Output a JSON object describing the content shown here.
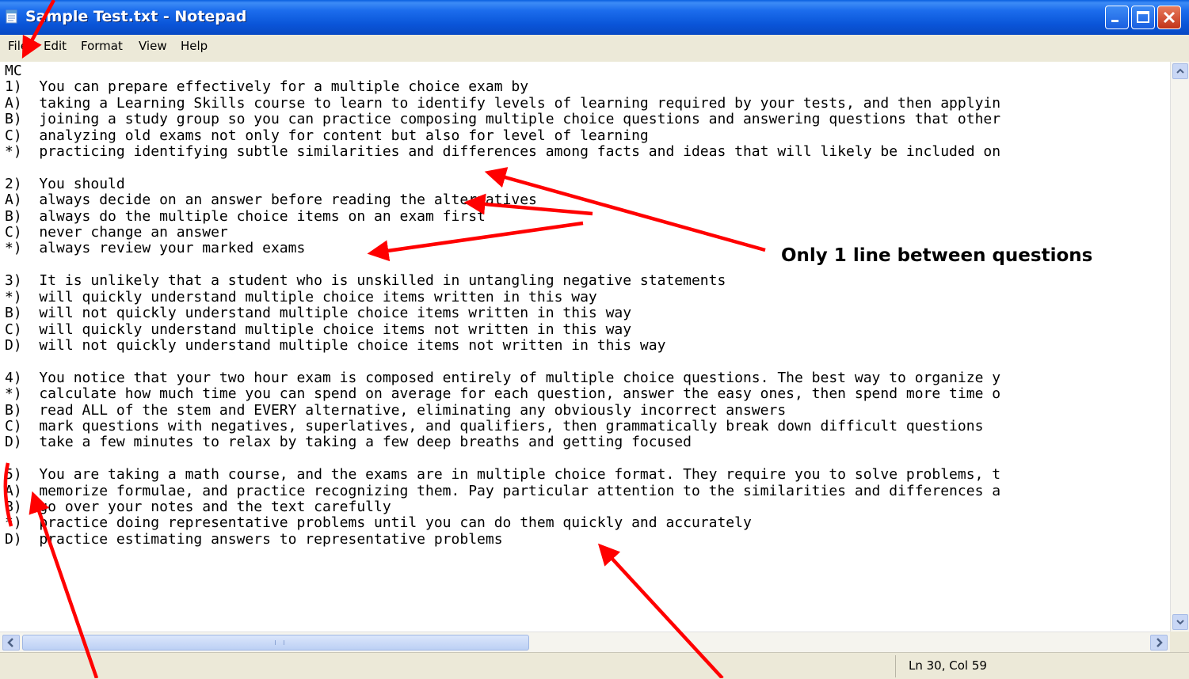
{
  "window": {
    "title": "Sample Test.txt - Notepad",
    "title_icon": "notepad-icon",
    "controls": {
      "minimize_icon": "minimize-icon",
      "maximize_icon": "maximize-icon",
      "close_icon": "close-icon"
    }
  },
  "menu": [
    "File",
    "Edit",
    "Format",
    "View",
    "Help"
  ],
  "editor": {
    "lines": [
      "MC",
      "1)  You can prepare effectively for a multiple choice exam by",
      "A)  taking a Learning Skills course to learn to identify levels of learning required by your tests, and then applyin",
      "B)  joining a study group so you can practice composing multiple choice questions and answering questions that other",
      "C)  analyzing old exams not only for content but also for level of learning",
      "*)  practicing identifying subtle similarities and differences among facts and ideas that will likely be included on",
      "",
      "2)  You should",
      "A)  always decide on an answer before reading the alternatives",
      "B)  always do the multiple choice items on an exam first",
      "C)  never change an answer",
      "*)  always review your marked exams",
      "",
      "3)  It is unlikely that a student who is unskilled in untangling negative statements",
      "*)  will quickly understand multiple choice items written in this way",
      "B)  will not quickly understand multiple choice items written in this way",
      "C)  will quickly understand multiple choice items not written in this way",
      "D)  will not quickly understand multiple choice items not written in this way",
      "",
      "4)  You notice that your two hour exam is composed entirely of multiple choice questions. The best way to organize y",
      "*)  calculate how much time you can spend on average for each question, answer the easy ones, then spend more time o",
      "B)  read ALL of the stem and EVERY alternative, eliminating any obviously incorrect answers",
      "C)  mark questions with negatives, superlatives, and qualifiers, then grammatically break down difficult questions",
      "D)  take a few minutes to relax by taking a few deep breaths and getting focused",
      "",
      "5)  You are taking a math course, and the exams are in multiple choice format. They require you to solve problems, t",
      "A)  memorize formulae, and practice recognizing them. Pay particular attention to the similarities and differences a",
      "B)  go over your notes and the text carefully",
      "*)  practice doing representative problems until you can do them quickly and accurately",
      "D)  practice estimating answers to representative problems"
    ]
  },
  "scrollbars": {
    "up_icon": "scroll-up-arrow-icon",
    "down_icon": "scroll-down-arrow-icon",
    "left_icon": "scroll-left-arrow-icon",
    "right_icon": "scroll-right-arrow-icon"
  },
  "status": {
    "position": "Ln 30, Col 59"
  },
  "annotation": {
    "label": "Only 1 line between questions",
    "arrow_color": "#ff0000"
  }
}
